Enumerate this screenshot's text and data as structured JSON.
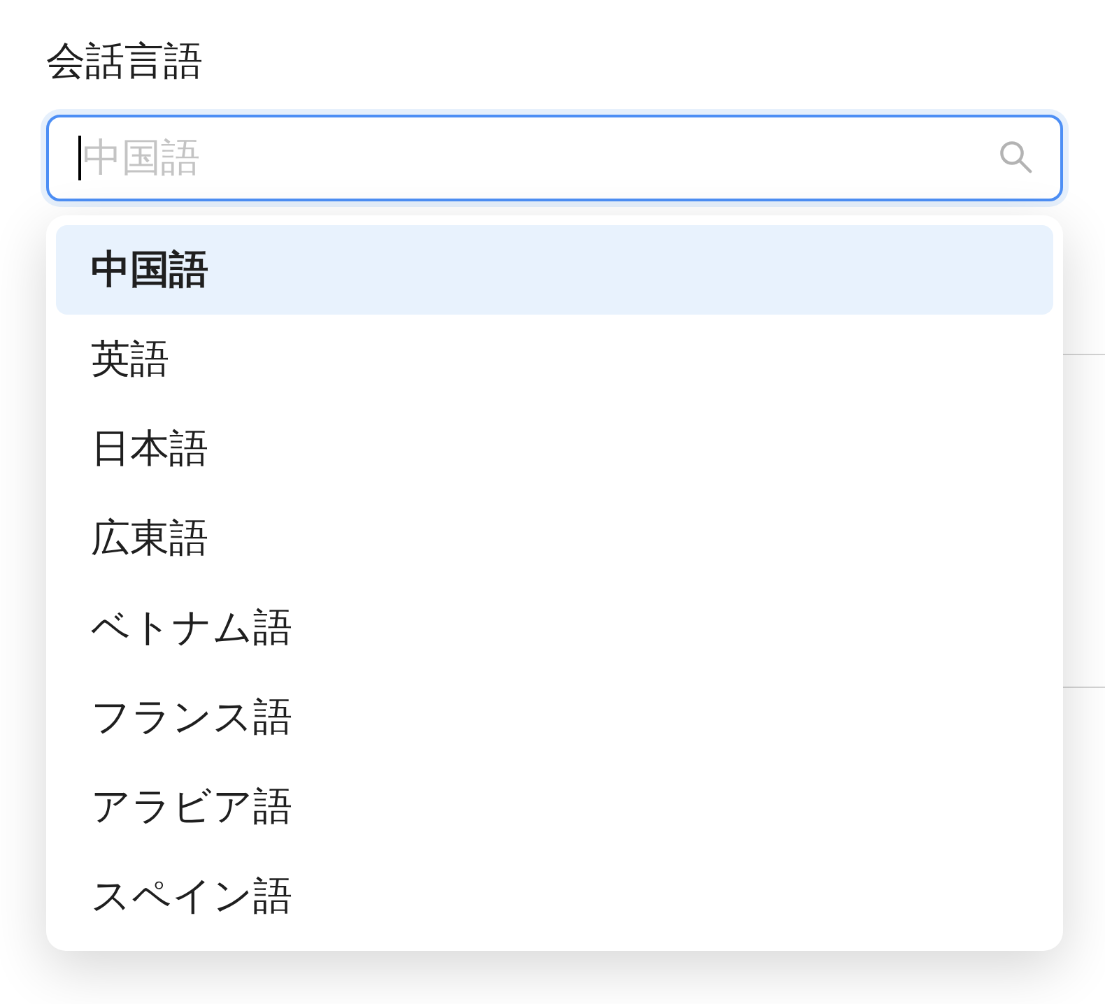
{
  "field": {
    "label": "会話言語",
    "placeholder": "中国語",
    "focused": true
  },
  "dropdown": {
    "options": [
      {
        "label": "中国語",
        "selected": true
      },
      {
        "label": "英語",
        "selected": false
      },
      {
        "label": "日本語",
        "selected": false
      },
      {
        "label": "広東語",
        "selected": false
      },
      {
        "label": "ベトナム語",
        "selected": false
      },
      {
        "label": "フランス語",
        "selected": false
      },
      {
        "label": "アラビア語",
        "selected": false
      },
      {
        "label": "スペイン語",
        "selected": false
      }
    ]
  }
}
